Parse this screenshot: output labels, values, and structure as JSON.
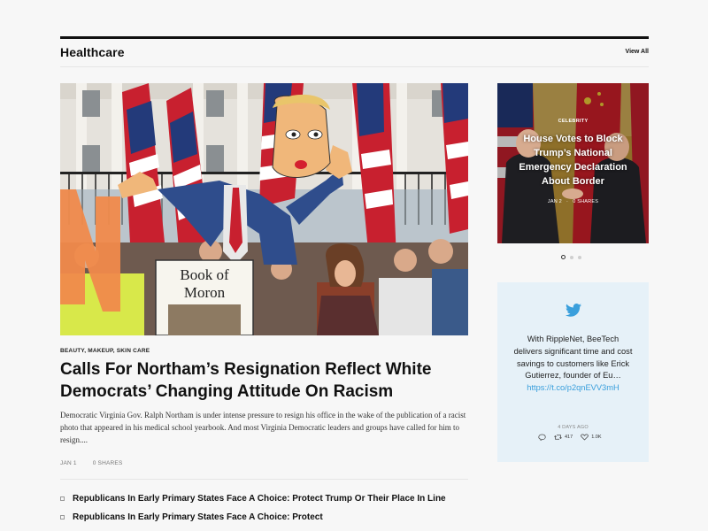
{
  "section": {
    "title": "Healthcare",
    "view_all_label": "View All"
  },
  "hero": {
    "image_alt": "Protest crowd with flags and a large caricature puppet",
    "sign_text_line1": "Book of",
    "sign_text_line2": "Moron"
  },
  "article": {
    "categories": "BEAUTY, MAKEUP, SKIN CARE",
    "headline": "Calls For Northam’s Resignation Reflect White Democrats’ Changing Attitude On Racism",
    "excerpt": "Democratic Virginia Gov. Ralph Northam is under intense pressure to resign his office in the wake of the publication of a racist photo that appeared in his medical school yearbook. And most Virginia Democratic leaders and groups have called for him to resign....",
    "date": "JAN 1",
    "shares": "0 SHARES"
  },
  "related": [
    {
      "title": "Republicans In Early Primary States Face A Choice: Protect Trump Or Their Place In Line"
    },
    {
      "title": "Republicans In Early Primary States Face A Choice: Protect"
    }
  ],
  "slider": {
    "category": "CELEBRITY",
    "title": "House Votes to Block Trump’s National Emergency Declaration About Border",
    "date": "JAN 2",
    "shares": "0 SHARES",
    "total_slides": 3,
    "active_slide": 1
  },
  "twitter": {
    "icon": "twitter-bird-icon",
    "text": "With RippleNet, BeeTech delivers significant time and cost savings to customers like Erick Gutierrez, founder of Eu…",
    "link": "https://t.co/p2qnEVV3mH",
    "time": "4 DAYS AGO",
    "retweets": "417",
    "likes": "1.0K",
    "accent": "#3a9fdc"
  }
}
